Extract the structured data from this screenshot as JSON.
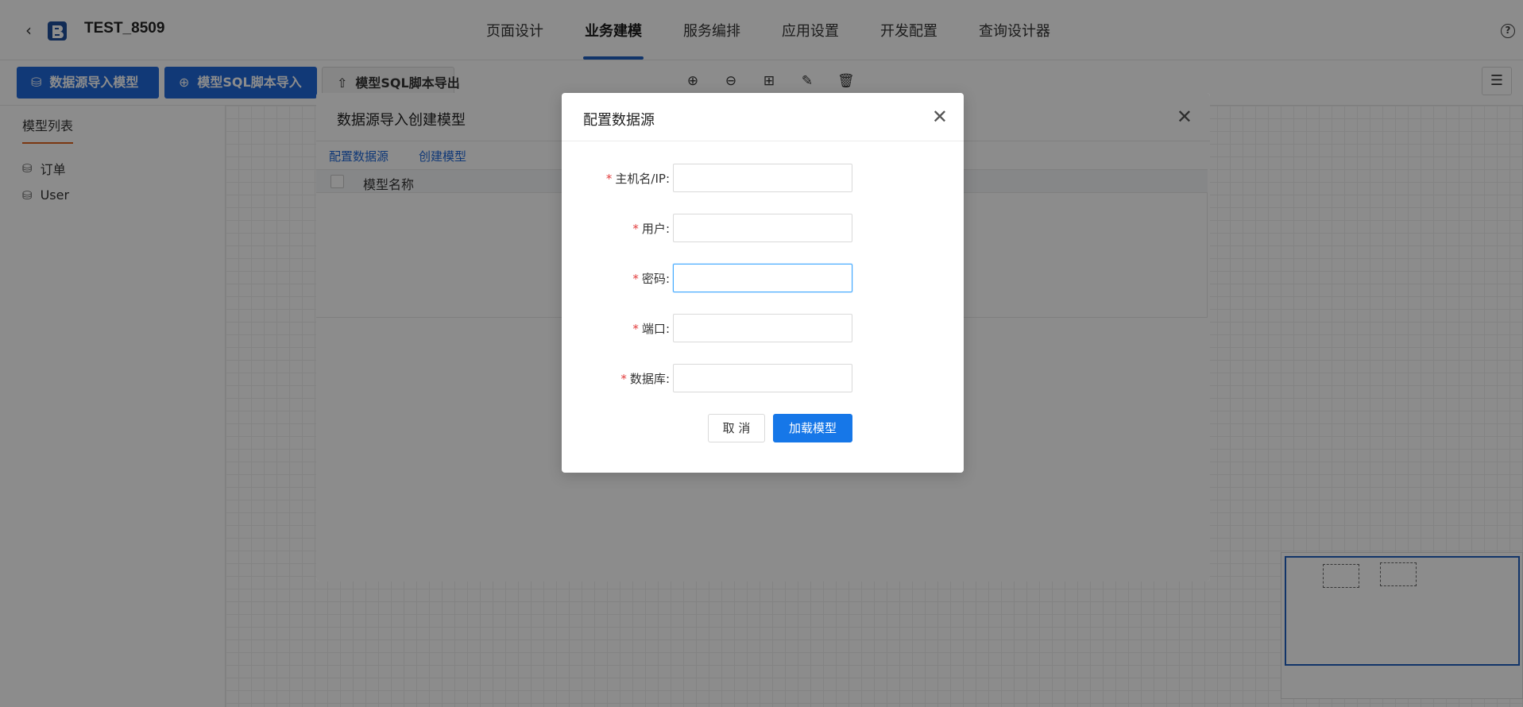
{
  "header": {
    "back_icon": "chevron-left",
    "app_title": "TEST_8509",
    "tabs": [
      {
        "label": "页面设计",
        "active": false
      },
      {
        "label": "业务建模",
        "active": true
      },
      {
        "label": "服务编排",
        "active": false
      },
      {
        "label": "应用设置",
        "active": false
      },
      {
        "label": "开发配置",
        "active": false
      },
      {
        "label": "查询设计器",
        "active": false
      }
    ],
    "help_icon": "?"
  },
  "toolbar": {
    "import_datasource_label": "数据源导入模型",
    "import_sql_label": "模型SQL脚本导入",
    "export_sql_label": "模型SQL脚本导出",
    "accent_color": "#1f68d9"
  },
  "left_panel": {
    "tab_label": "模型列表",
    "models": [
      {
        "label": "订单"
      },
      {
        "label": "User"
      }
    ]
  },
  "import_modal": {
    "title": "数据源导入创建模型",
    "steps": [
      "配置数据源",
      "创建模型"
    ],
    "table": {
      "columns": [
        "模型名称"
      ]
    }
  },
  "config_modal": {
    "title": "配置数据源",
    "fields": [
      {
        "label": "主机名/IP",
        "value": "",
        "required": true
      },
      {
        "label": "用户",
        "value": "",
        "required": true
      },
      {
        "label": "密码",
        "value": "",
        "required": true
      },
      {
        "label": "端口",
        "value": "",
        "required": true
      },
      {
        "label": "数据库",
        "value": "",
        "required": true
      }
    ],
    "colon": ":",
    "required_mark": "*",
    "cancel_label": "取 消",
    "submit_label": "加载模型",
    "submit_color": "#1677e8"
  }
}
